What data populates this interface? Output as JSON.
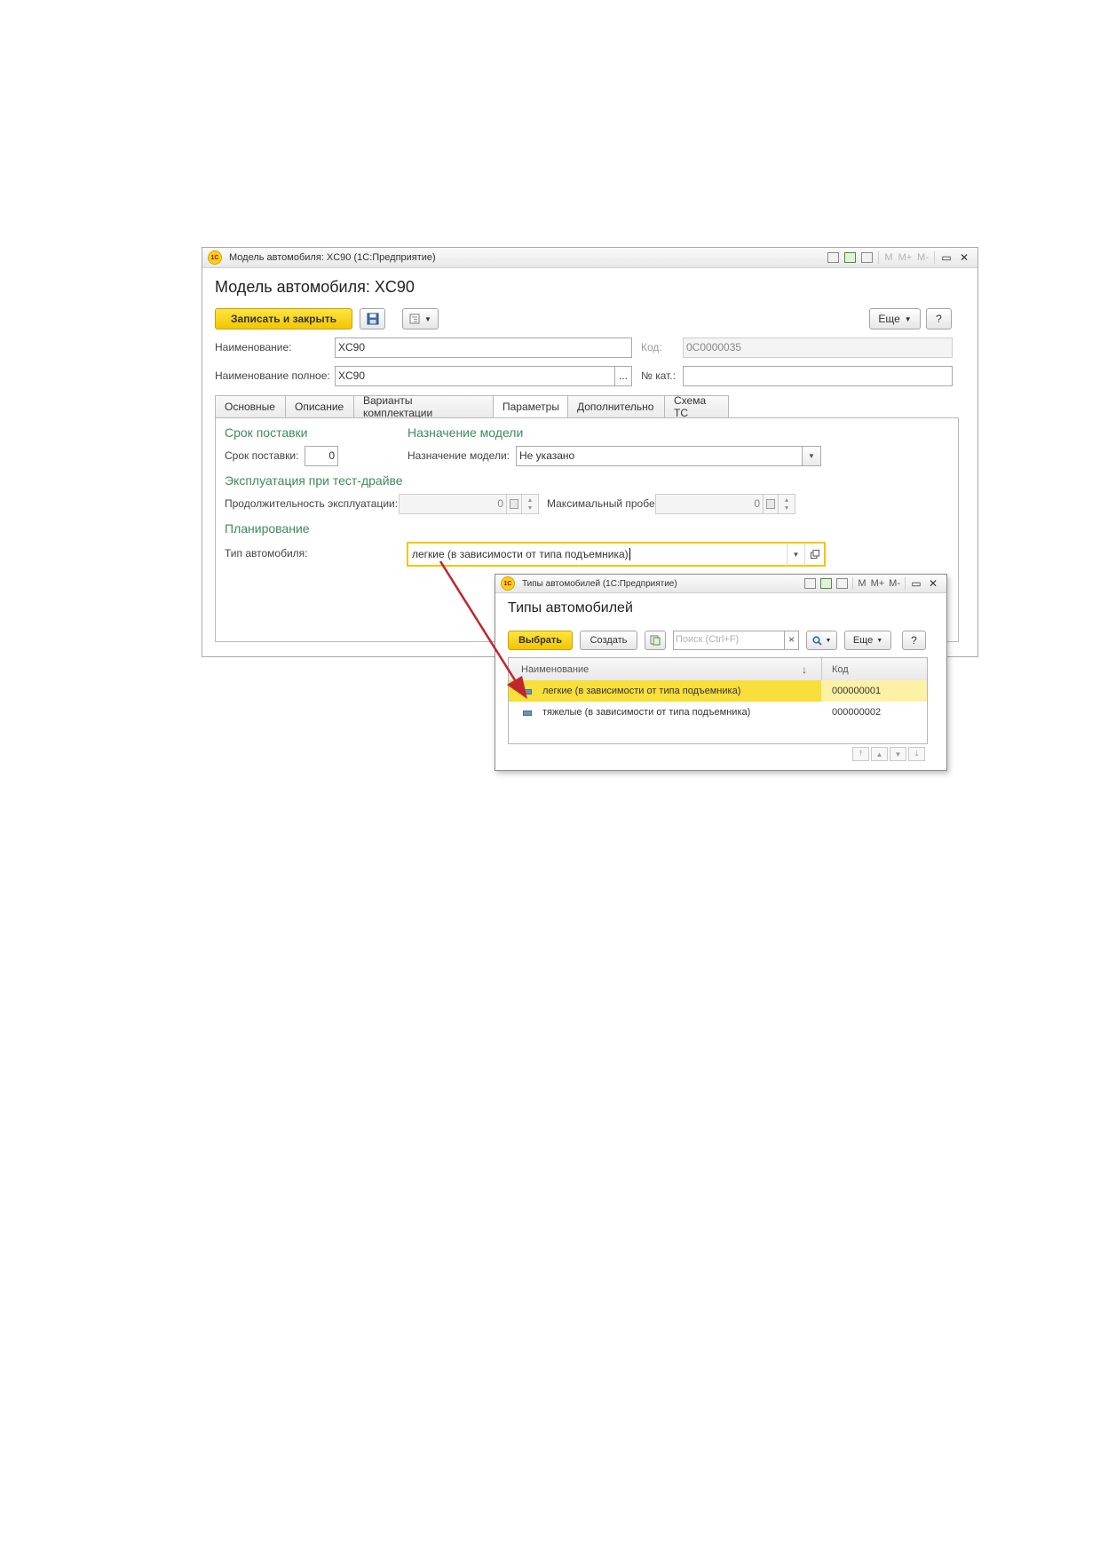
{
  "main_window": {
    "window_title": "Модель автомобиля: XC90 (1С:Предприятие)",
    "toolbar_m_labels": [
      "M",
      "M+",
      "M-"
    ],
    "form_title": "Модель автомобиля: XC90",
    "save_close_label": "Записать и закрыть",
    "more_label": "Еще",
    "help_label": "?",
    "fields": {
      "name_label": "Наименование:",
      "name_value": "XC90",
      "code_label": "Код:",
      "code_value": "0C0000035",
      "full_name_label": "Наименование полное:",
      "full_name_value": "XC90",
      "catalog_label": "№ кат.:",
      "catalog_value": "",
      "ellipsis": "..."
    },
    "tabs": [
      "Основные",
      "Описание",
      "Варианты комплектации",
      "Параметры",
      "Дополнительно",
      "Схема ТС"
    ],
    "active_tab": "Параметры",
    "params": {
      "delivery_section": "Срок поставки",
      "delivery_label": "Срок поставки:",
      "delivery_value": "0",
      "purpose_section": "Назначение модели",
      "purpose_label": "Назначение модели:",
      "purpose_value": "Не указано",
      "testdrive_section": "Эксплуатация при тест-драйве",
      "duration_label": "Продолжительность эксплуатации:",
      "duration_value": "0",
      "mileage_label": "Максимальный пробег:",
      "mileage_value": "0",
      "planning_section": "Планирование",
      "car_type_label": "Тип автомобиля:",
      "car_type_value": "легкие (в зависимости от типа подъемника)"
    }
  },
  "popup": {
    "window_title": "Типы автомобилей (1С:Предприятие)",
    "toolbar_m_labels": [
      "M",
      "M+",
      "M-"
    ],
    "form_title": "Типы автомобилей",
    "select_label": "Выбрать",
    "create_label": "Создать",
    "search_placeholder": "Поиск (Ctrl+F)",
    "clear_label": "×",
    "more_label": "Еще",
    "help_label": "?",
    "columns": {
      "name": "Наименование",
      "sort": "↓",
      "code": "Код"
    },
    "rows": [
      {
        "name": "легкие (в зависимости от типа подъемника)",
        "code": "000000001"
      },
      {
        "name": "тяжелые (в зависимости от типа подъемника)",
        "code": "000000002"
      }
    ],
    "selected_row": 0
  },
  "colors": {
    "accent_yellow": "#f8df3b",
    "section_green": "#3f8a5a",
    "arrow_red": "#c0262d"
  }
}
